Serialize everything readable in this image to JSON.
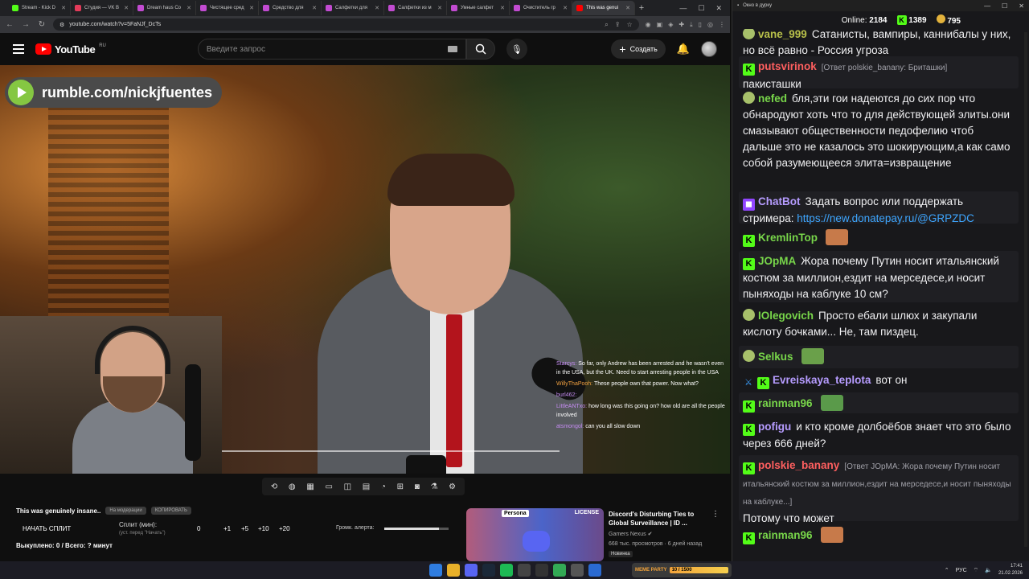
{
  "browser": {
    "tabs": [
      {
        "label": "Stream - Kick D",
        "color": "#53fc18"
      },
      {
        "label": "Студия — VK В",
        "color": "#e33b5a"
      },
      {
        "label": "Dream haus Co",
        "color": "#c24bd1"
      },
      {
        "label": "Чистящее сред",
        "color": "#c24bd1"
      },
      {
        "label": "Средство для",
        "color": "#c24bd1"
      },
      {
        "label": "Салфетки для",
        "color": "#c24bd1"
      },
      {
        "label": "Салфетки из м",
        "color": "#c24bd1"
      },
      {
        "label": "Умные салфет",
        "color": "#c24bd1"
      },
      {
        "label": "Очиститель гр",
        "color": "#c24bd1"
      },
      {
        "label": "This was genui",
        "color": "#ff0000"
      }
    ],
    "url": "youtube.com/watch?v=5FaNJf_DcTs"
  },
  "youtube": {
    "logo_text": "YouTube",
    "region": "RU",
    "search_placeholder": "Введите запрос",
    "create_label": "Создать"
  },
  "video": {
    "rumble_text": "rumble.com/nickjfuentes",
    "overlay_chat": [
      {
        "name": "Starcys:",
        "text": "So far, only Andrew has been arrested and he wasn't even in the USA, but the UK. Need to start arresting people in the USA",
        "style": ""
      },
      {
        "name": "WillyThaPooh:",
        "text": "These people own that power. Now what?",
        "style": "o"
      },
      {
        "name": "burl462:",
        "text": "",
        "style": ""
      },
      {
        "name": "LittleANTxo:",
        "text": "how long was this going on? how old are all the people involved",
        "style": ""
      },
      {
        "name": "atsmongol:",
        "text": "can you all slow down",
        "style": ""
      }
    ]
  },
  "panel": {
    "video_title": "This was genuinely insane..",
    "pill_1": "На модерации",
    "pill_2": "КОПИРОВАТЬ",
    "split_button": "НАЧАТЬ СПЛИТ",
    "split_label": "Сплит (мин):",
    "split_hint": "(уст. перед \"Начать\")",
    "split_values": [
      "0",
      "+1",
      "+5",
      "+10",
      "+20"
    ],
    "alert_label": "Громк. алерта:",
    "alert_level": 0.85,
    "bought": "Выкуплено: 0 / Всего: ? минут"
  },
  "recommendation": {
    "title": "Discord's Disturbing Ties to Global Surveillance | ID ...",
    "channel": "Gamers Nexus",
    "meta": "668 тыс. просмотров · 6 дней назад",
    "badge_new": "Новинка",
    "thumb_badge": "Persona",
    "thumb_license": "LICENSE"
  },
  "chat": {
    "window_title": "Окно в дурку",
    "online_label": "Online:",
    "online_count": "2184",
    "kick_count": "1389",
    "coin_count": "795",
    "messages": [
      {
        "user": "vane_999",
        "color": "#b8c04a",
        "text": "Сатанисты, вампиры, каннибалы у них, но всё равно - Россия угроза",
        "reply": "",
        "badge": "face"
      },
      {
        "user": "putsvirinok",
        "color": "#ff5f5f",
        "text": "пакисташки",
        "reply": "[Ответ polskie_banany: Бриташки]",
        "badge": "k"
      },
      {
        "user": "nefed",
        "color": "#78d64a",
        "text": "бля,эти гои надеются до сих пор что обнародуют хоть что то для действующей элиты.они смазывают общественности педофелию чтоб дальше это не казалось это шокирующим,а как само собой разумеющееся элита=извращение",
        "reply": "",
        "badge": "face"
      },
      {
        "user": "ChatBot",
        "color": "#b69cff",
        "text": "Задать вопрос или поддержать стримера: ",
        "link": "https://new.donatepay.ru/@GRPZDC",
        "reply": "",
        "badge": "bot"
      },
      {
        "user": "KremlinTop",
        "color": "#78d64a",
        "text": "",
        "reply": "",
        "badge": "k",
        "emote": "#c77a4a"
      },
      {
        "user": "JOpMA",
        "color": "#78d64a",
        "text": "Жора почему Путин носит итальянский костюм за миллион,ездит на мерседесе,и носит пыняходы на каблуке 10 см?",
        "reply": "",
        "badge": "k"
      },
      {
        "user": "IOlegovich",
        "color": "#78d64a",
        "text": "Просто ебали шлюх и закупали кислоту бочками... Не, там пиздец.",
        "reply": "",
        "badge": "face"
      },
      {
        "user": "Selkus",
        "color": "#78d64a",
        "text": "",
        "reply": "",
        "badge": "face",
        "emote": "#6aa04a"
      },
      {
        "user": "Evreiskaya_teplota",
        "color": "#b69cff",
        "text": "вот он",
        "reply": "",
        "badge": "sw"
      },
      {
        "user": "rainman96",
        "color": "#78d64a",
        "text": "",
        "reply": "",
        "badge": "k",
        "emote": "#5a9a4a"
      },
      {
        "user": "pofigu",
        "color": "#b69cff",
        "text": "и кто кроме долбоёбов знает что это было через 666 дней?",
        "reply": "",
        "badge": "k"
      },
      {
        "user": "polskie_banany",
        "color": "#ff5f5f",
        "text": "Потому что может",
        "reply": "[Ответ JOpMA: Жора почему Путин носит итальянский костюм за миллион,ездит на мерседесе,и носит пыняходы на каблуке...]",
        "badge": "k"
      },
      {
        "user": "rainman96",
        "color": "#78d64a",
        "text": "",
        "reply": "",
        "badge": "k",
        "emote": "#c77a4a"
      }
    ]
  },
  "taskbar": {
    "meme_label": "MEME PARTY",
    "meme_value": "10 / 1500",
    "lang": "РУС",
    "time": "17:41",
    "date": "21.02.2026"
  }
}
